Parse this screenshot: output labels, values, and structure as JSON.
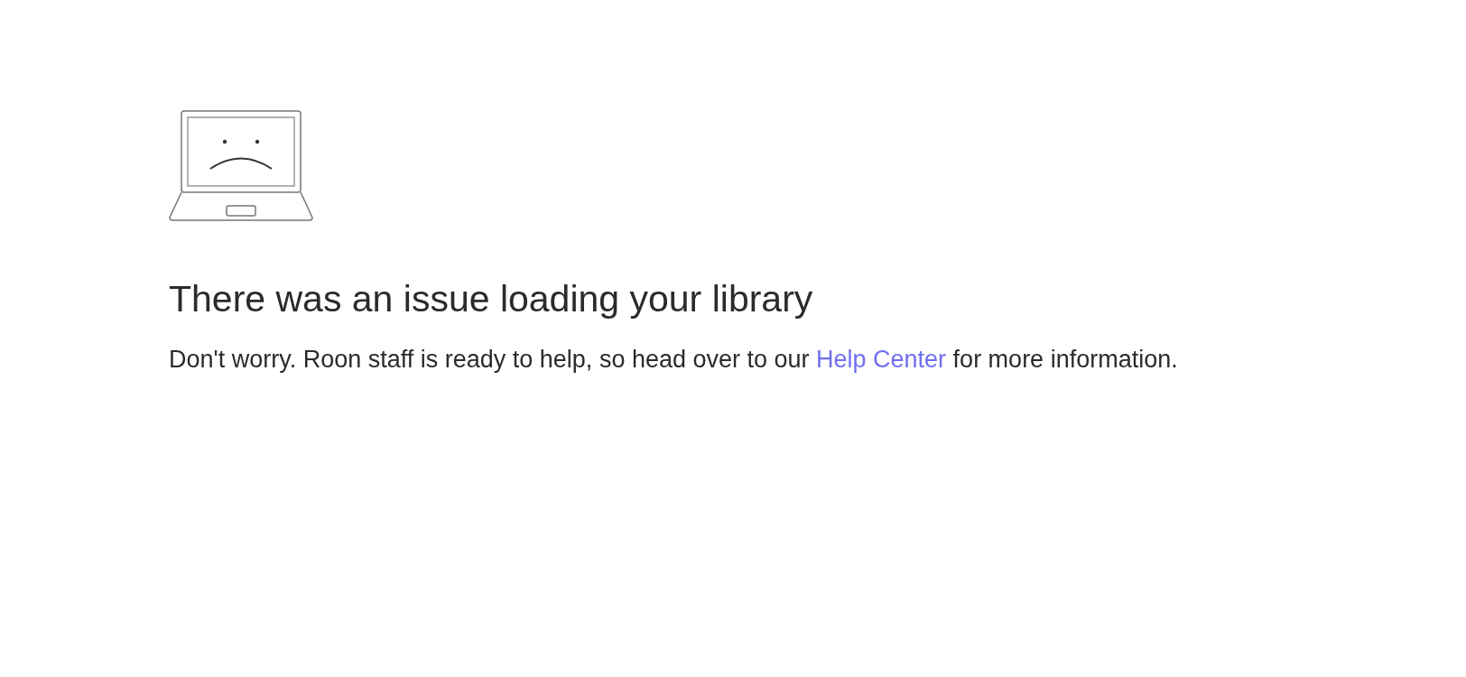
{
  "error": {
    "title": "There was an issue loading your library",
    "message": {
      "before": "Don't worry. Roon staff is ready to help, so head over to our ",
      "link": "Help Center",
      "after": " for more information."
    }
  }
}
